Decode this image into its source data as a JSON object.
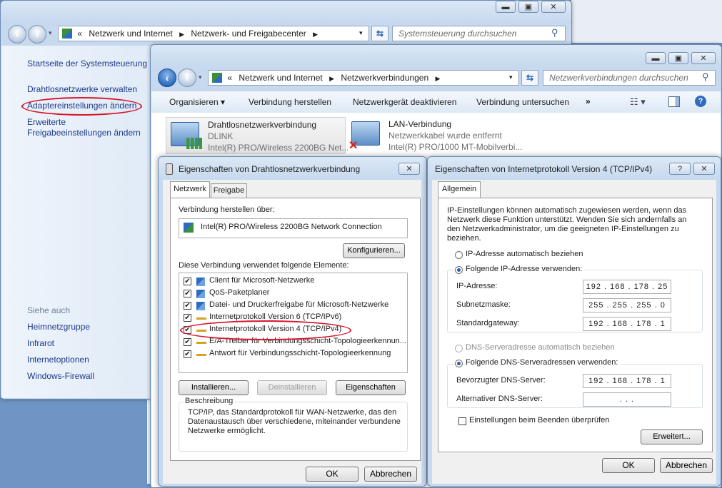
{
  "network_center": {
    "breadcrumb": [
      "Netzwerk und Internet",
      "Netzwerk- und Freigabecenter"
    ],
    "search_placeholder": "Systemsteuerung durchsuchen",
    "sidebar": {
      "home": "Startseite der Systemsteuerung",
      "items": [
        "Drahtlosnetzwerke verwalten",
        "Adaptereinstellungen ändern",
        "Erweiterte",
        "Freigabeeinstellungen ändern"
      ],
      "see_also": "Siehe auch",
      "see_also_items": [
        "Heimnetzgruppe",
        "Infrarot",
        "Internetoptionen",
        "Windows-Firewall"
      ]
    }
  },
  "connections": {
    "breadcrumb": [
      "Netzwerk und Internet",
      "Netzwerkverbindungen"
    ],
    "search_placeholder": "Netzwerkverbindungen durchsuchen",
    "toolbar": [
      "Organisieren ▾",
      "Verbindung herstellen",
      "Netzwerkgerät deaktivieren",
      "Verbindung untersuchen",
      "»"
    ],
    "adapters": [
      {
        "name": "Drahtlosnetzwerkverbindung",
        "status": "DLINK",
        "device": "Intel(R) PRO/Wireless 2200BG Net..."
      },
      {
        "name": "LAN-Verbindung",
        "status": "Netzwerkkabel wurde entfernt",
        "device": "Intel(R) PRO/1000 MT-Mobilverbi..."
      }
    ]
  },
  "wlan_props": {
    "title": "Eigenschaften von Drahtlosnetzwerkverbindung",
    "tabs": [
      "Netzwerk",
      "Freigabe"
    ],
    "connect_using_label": "Verbindung herstellen über:",
    "adapter": "Intel(R) PRO/Wireless 2200BG Network Connection",
    "configure": "Konfigurieren...",
    "items_label": "Diese Verbindung verwendet folgende Elemente:",
    "items": [
      "Client für Microsoft-Netzwerke",
      "QoS-Paketplaner",
      "Datei- und Druckerfreigabe für Microsoft-Netzwerke",
      "Internetprotokoll Version 6 (TCP/IPv6)",
      "Internetprotokoll Version 4 (TCP/IPv4)",
      "E/A-Treiber für Verbindungsschicht-Topologieerkennun...",
      "Antwort für Verbindungsschicht-Topologieerkennung"
    ],
    "install": "Installieren...",
    "uninstall": "Deinstallieren",
    "properties": "Eigenschaften",
    "description_label": "Beschreibung",
    "description": "TCP/IP, das Standardprotokoll für WAN-Netzwerke, das den Datenaustausch über verschiedene, miteinander verbundene Netzwerke ermöglicht.",
    "ok": "OK",
    "cancel": "Abbrechen"
  },
  "ipv4_props": {
    "title": "Eigenschaften von Internetprotokoll Version 4 (TCP/IPv4)",
    "help": "?",
    "tab": "Allgemein",
    "intro": "IP-Einstellungen können automatisch zugewiesen werden, wenn das Netzwerk diese Funktion unterstützt. Wenden Sie sich andernfalls an den Netzwerkadministrator, um die geeigneten IP-Einstellungen zu beziehen.",
    "ip_auto": "IP-Adresse automatisch beziehen",
    "ip_manual": "Folgende IP-Adresse verwenden:",
    "ip_label": "IP-Adresse:",
    "ip_value": "192 . 168 . 178 . 25",
    "mask_label": "Subnetzmaske:",
    "mask_value": "255 . 255 . 255 . 0",
    "gw_label": "Standardgateway:",
    "gw_value": "192 . 168 . 178 . 1",
    "dns_auto": "DNS-Serveradresse automatisch beziehen",
    "dns_manual": "Folgende DNS-Serveradressen verwenden:",
    "dns1_label": "Bevorzugter DNS-Server:",
    "dns1_value": "192 . 168 . 178 . 1",
    "dns2_label": "Alternativer DNS-Server:",
    "dns2_value": ".       .       .",
    "validate": "Einstellungen beim Beenden überprüfen",
    "advanced": "Erweitert...",
    "ok": "OK",
    "cancel": "Abbrechen"
  }
}
